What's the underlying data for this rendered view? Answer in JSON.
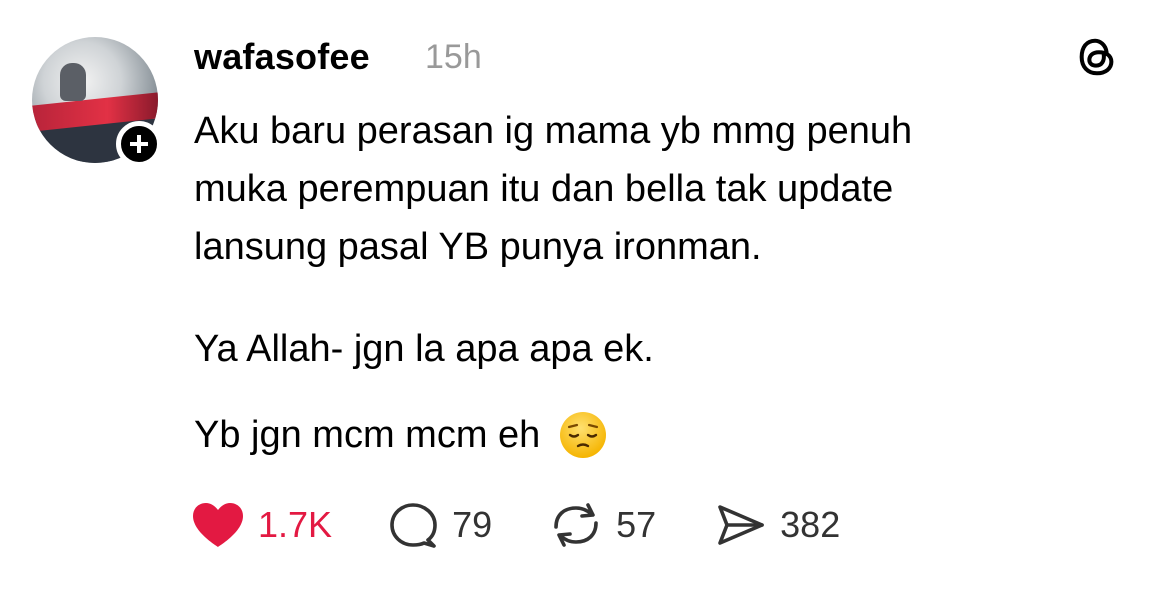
{
  "post": {
    "username": "wafasofee",
    "timestamp": "15h",
    "lines": [
      "Aku baru perasan ig mama yb mmg penuh",
      "muka perempuan itu dan bella tak update",
      "lansung pasal YB punya ironman."
    ],
    "paragraph2": "Ya Allah- jgn la apa apa ek.",
    "paragraph3": "Yb jgn mcm mcm eh",
    "emoji": "pensive-face"
  },
  "actions": {
    "likes": "1.7K",
    "comments": "79",
    "reposts": "57",
    "shares": "382"
  },
  "colors": {
    "like": "#e31942",
    "muted": "#999999",
    "text": "#000000"
  },
  "icons": [
    "plus-icon",
    "threads-logo-icon",
    "heart-icon",
    "comment-icon",
    "repost-icon",
    "share-icon"
  ]
}
